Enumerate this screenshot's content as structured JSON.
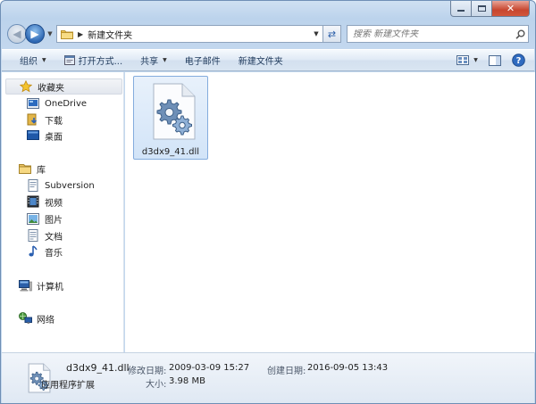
{
  "window": {
    "minimize": "",
    "maximize": "",
    "close": "✕"
  },
  "address": {
    "path": "新建文件夹",
    "search_placeholder": "搜索 新建文件夹"
  },
  "toolbar": {
    "organize": "组织",
    "open_with": "打开方式...",
    "share": "共享",
    "email": "电子邮件",
    "new_folder": "新建文件夹"
  },
  "sidebar": {
    "favorites": "收藏夹",
    "favorites_items": [
      "OneDrive",
      "下载",
      "桌面"
    ],
    "libraries": "库",
    "library_items": [
      "Subversion",
      "视频",
      "图片",
      "文档",
      "音乐"
    ],
    "computer": "计算机",
    "network": "网络"
  },
  "files": [
    {
      "name": "d3dx9_41.dll"
    }
  ],
  "details": {
    "name": "d3dx9_41.dll",
    "type": "应用程序扩展",
    "modified_label": "修改日期:",
    "modified_value": "2009-03-09 15:27",
    "created_label": "创建日期:",
    "created_value": "2016-09-05 13:43",
    "size_label": "大小:",
    "size_value": "3.98 MB"
  },
  "colors": {
    "accent": "#2e68b4",
    "selection": "#d2e4f8",
    "close": "#c7462f"
  }
}
